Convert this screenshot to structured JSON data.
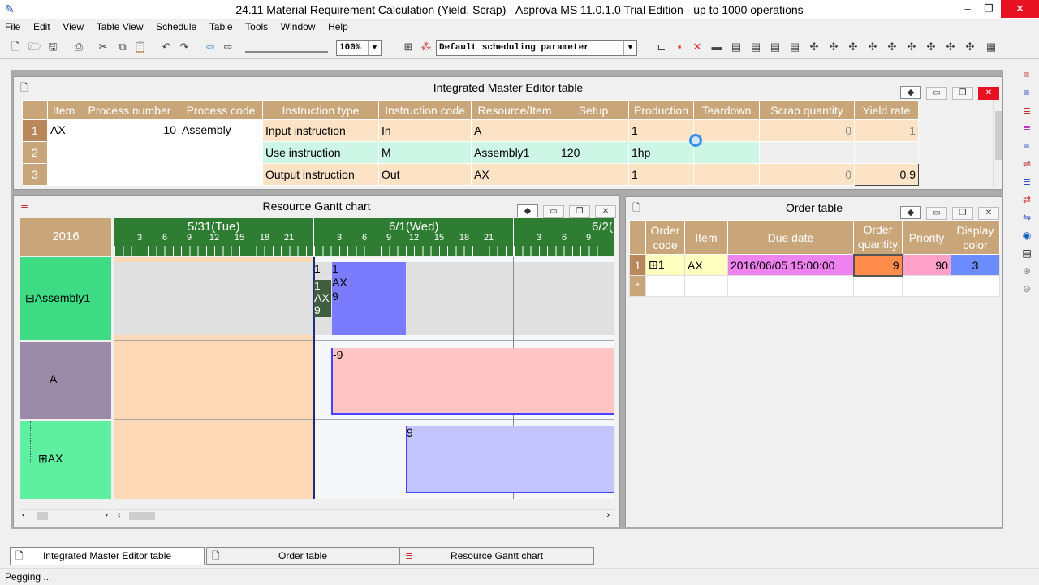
{
  "window": {
    "title": "24.11 Material Requirement Calculation (Yield, Scrap) - Asprova MS 11.0.1.0 Trial Edition  - up to 1000 operations",
    "minimize": "–",
    "restore": "❐",
    "close": "✕"
  },
  "menu": [
    "File",
    "Edit",
    "View",
    "Table View",
    "Schedule",
    "Table",
    "Tools",
    "Window",
    "Help"
  ],
  "toolbar": {
    "zoom": "100%",
    "schedule_param": "Default scheduling parameter"
  },
  "ime": {
    "title": "Integrated Master Editor table",
    "columns": [
      "Item",
      "Process number",
      "Process code",
      "Instruction type",
      "Instruction code",
      "Resource/Item",
      "Setup",
      "Production",
      "Teardown",
      "Scrap quantity",
      "Yield rate"
    ],
    "item": "AX",
    "process_number": "10",
    "process_code": "Assembly",
    "rows": [
      {
        "num": "1",
        "type": "Input instruction",
        "code": "In",
        "res": "A",
        "setup": "",
        "production": "1",
        "teardown": "",
        "scrap": "0",
        "yield": "1"
      },
      {
        "num": "2",
        "type": "Use instruction",
        "code": "M",
        "res": "Assembly1",
        "setup": "120",
        "production": "1hp",
        "teardown": "",
        "scrap": "",
        "yield": ""
      },
      {
        "num": "3",
        "type": "Output instruction",
        "code": "Out",
        "res": "AX",
        "setup": "",
        "production": "1",
        "teardown": "",
        "scrap": "0",
        "yield": "0.9"
      }
    ]
  },
  "gantt": {
    "title": "Resource Gantt chart",
    "year": "2016",
    "days": [
      "5/31(Tue)",
      "6/1(Wed)",
      "6/2("
    ],
    "hours": [
      "3",
      "6",
      "9",
      "12",
      "15",
      "18",
      "21"
    ],
    "resources": [
      {
        "prefix": "⊟",
        "name": "Assembly1"
      },
      {
        "prefix": "",
        "name": "A"
      },
      {
        "prefix": "⊞",
        "name": "AX"
      }
    ],
    "bar_dark_lines": [
      "1",
      "AX",
      "9"
    ],
    "bar_blue_lines": [
      "1",
      "AX",
      "9"
    ],
    "bar_a_label": "-9",
    "bar_ax_label": "9"
  },
  "order": {
    "title": "Order table",
    "columns": [
      "Order code",
      "Item",
      "Due date",
      "Order quantity",
      "Priority",
      "Display color"
    ],
    "row": {
      "num": "1",
      "code": "1",
      "item": "AX",
      "due": "2016/06/05 15:00:00",
      "qty": "9",
      "priority": "90",
      "color": "3"
    },
    "new_row_marker": "*"
  },
  "tabs": [
    "Integrated Master Editor table",
    "Order table",
    "Resource Gantt chart"
  ],
  "status": "Pegging ...",
  "colors": {
    "header": "#c9a57a",
    "assembly_green": "#3ddc84",
    "a_purple": "#9b8aa8",
    "ax_green": "#5ef0a0",
    "bar_blue": "#7b7bff",
    "bar_pink": "#ffc4c4",
    "bar_lav": "#c4c4ff",
    "due_magenta": "#ee82ee",
    "qty_orange": "#ff8c4a",
    "prio_pink": "#ffa0c8",
    "disp_blue": "#6a8cff"
  }
}
